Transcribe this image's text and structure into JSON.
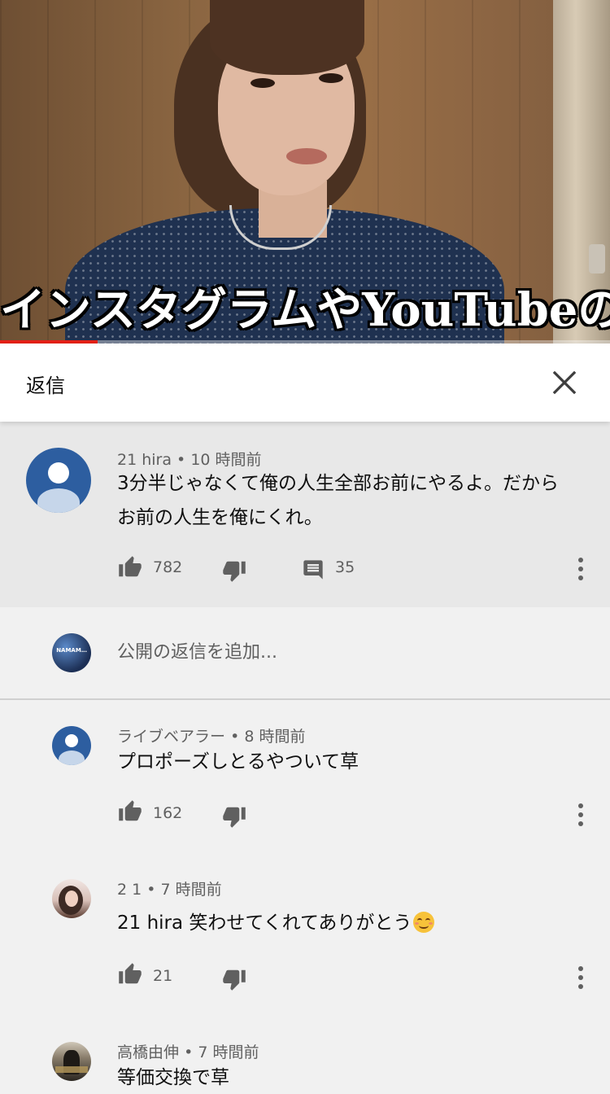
{
  "video": {
    "caption": "インスタグラムやYouTubeの",
    "progress_percent": 16
  },
  "panel": {
    "title": "返信",
    "close_icon": "close-icon"
  },
  "parent_comment": {
    "author": "21 hira",
    "time": "10 時間前",
    "text_lines": [
      "3分半じゃなくて俺の人生全部お前にやるよ。だから",
      "お前の人生を俺にくれ。"
    ],
    "likes": "782",
    "replies": "35"
  },
  "reply_box": {
    "avatar_text": "NAMAM…",
    "placeholder": "公開の返信を追加..."
  },
  "replies": [
    {
      "author": "ライブベアラー",
      "time": "8 時間前",
      "text": "プロポーズしとるやついて草",
      "likes": "162"
    },
    {
      "author": "2 1",
      "time": "7 時間前",
      "text": "21 hira 笑わせてくれてありがとう",
      "likes": "21"
    },
    {
      "author": "高橋由伸",
      "time": "7 時間前",
      "text": "等価交換で草"
    }
  ],
  "separator": "•",
  "colors": {
    "progress": "#e62117",
    "avatar_blue": "#2d5ea0",
    "icon_gray": "#606060",
    "highlight_bg": "#e8e8e8",
    "page_bg": "#f1f1f1"
  },
  "icons": [
    "thumbs-up-icon",
    "thumbs-down-icon",
    "comment-icon",
    "more-vert-icon",
    "close-icon",
    "smiling-face-emoji"
  ]
}
